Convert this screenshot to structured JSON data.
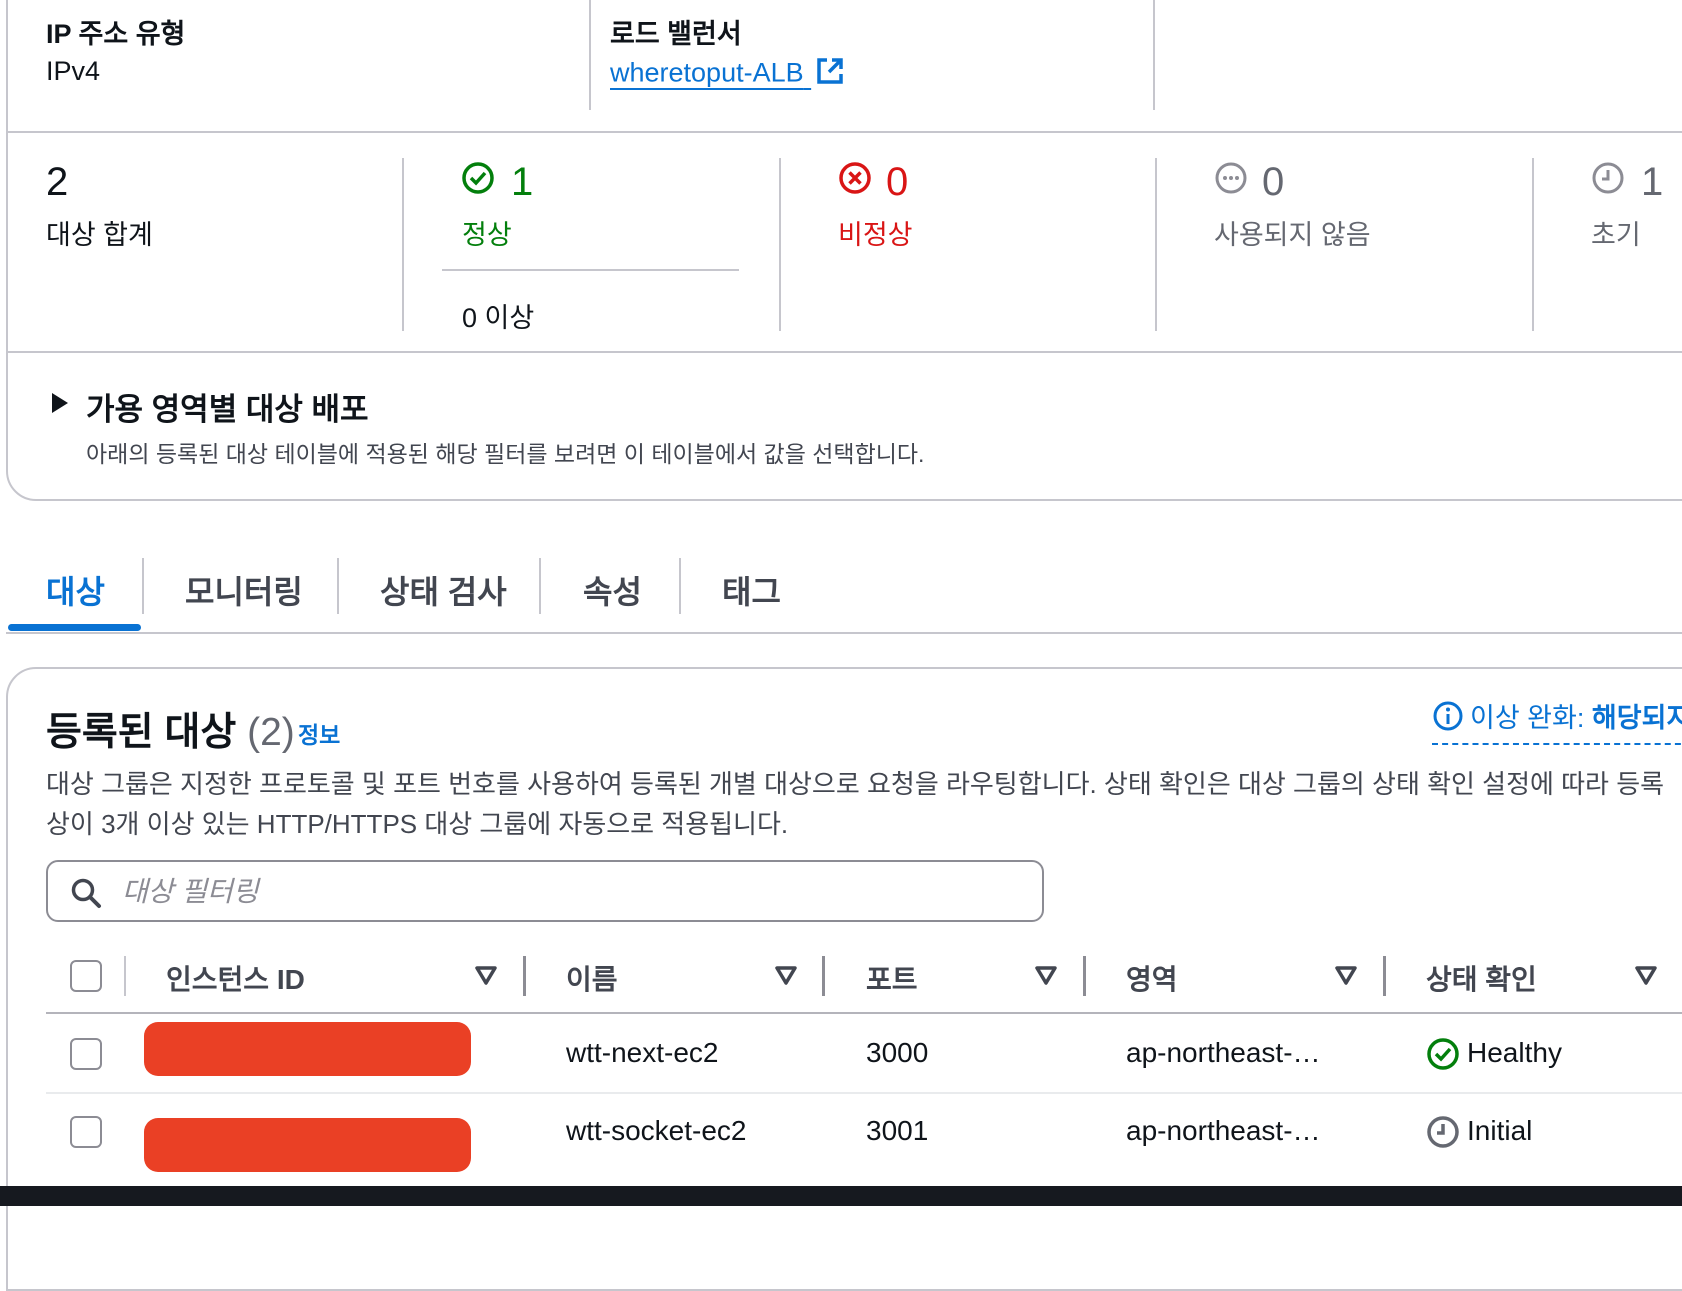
{
  "details": {
    "ip_type_label": "IP 주소 유형",
    "ip_type_value": "IPv4",
    "lb_label": "로드 밸런서",
    "lb_value": "wheretoput-ALB"
  },
  "stats": {
    "total": {
      "count": "2",
      "label": "대상 합계"
    },
    "healthy": {
      "count": "1",
      "label": "정상",
      "sub": "0 이상"
    },
    "unhealthy": {
      "count": "0",
      "label": "비정상"
    },
    "unused": {
      "count": "0",
      "label": "사용되지 않음"
    },
    "initial": {
      "count": "1",
      "label": "초기"
    }
  },
  "az_section": {
    "title": "가용 영역별 대상 배포",
    "description": "아래의 등록된 대상 테이블에 적용된 해당 필터를 보려면 이 테이블에서 값을 선택합니다."
  },
  "tabs": [
    "대상",
    "모니터링",
    "상태 검사",
    "속성",
    "태그"
  ],
  "registered": {
    "title": "등록된 대상",
    "count": "(2)",
    "info": "정보",
    "anomaly_prefix": "이상 완화:",
    "anomaly_value": "해당되지",
    "desc_line1": "대상 그룹은 지정한 프로토콜 및 포트 번호를 사용하여 등록된 개별 대상으로 요청을 라우팅합니다. 상태 확인은 대상 그룹의 상태 확인 설정에 따라 등록",
    "desc_line2": "상이 3개 이상 있는 HTTP/HTTPS 대상 그룹에 자동으로 적용됩니다.",
    "search_placeholder": "대상 필터링"
  },
  "table": {
    "columns": [
      "인스턴스 ID",
      "이름",
      "포트",
      "영역",
      "상태 확인"
    ],
    "rows": [
      {
        "name": "wtt-next-ec2",
        "port": "3000",
        "zone": "ap-northeast-…",
        "status": "Healthy"
      },
      {
        "name": "wtt-socket-ec2",
        "port": "3001",
        "zone": "ap-northeast-…",
        "status": "Initial"
      }
    ]
  },
  "colors": {
    "link": "#0972d3",
    "healthy": "#037f0c",
    "unhealthy": "#d91515",
    "muted": "#656871",
    "redaction": "#ea4025"
  }
}
